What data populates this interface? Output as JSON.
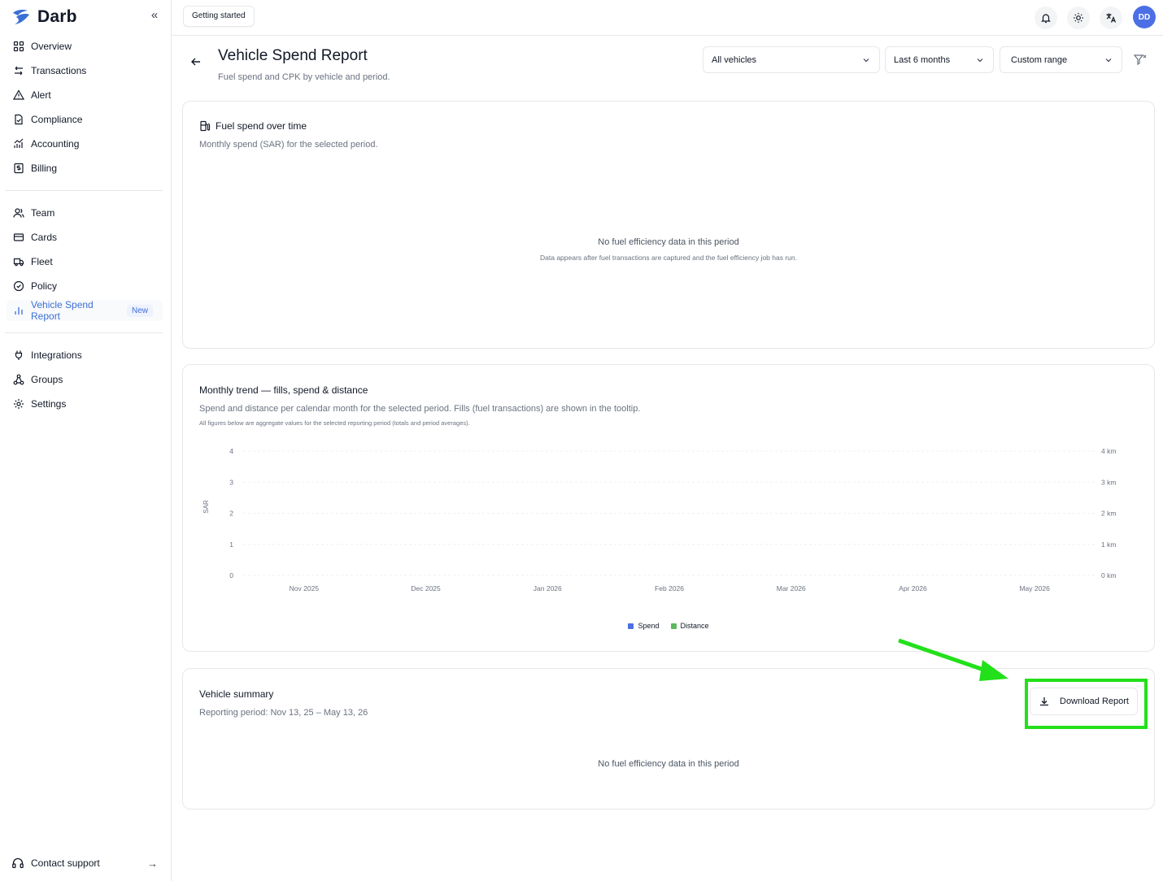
{
  "brand": {
    "name": "Darb",
    "accent": "#3b6fd6"
  },
  "sidebar": {
    "groups": [
      {
        "items": [
          {
            "label": "Overview",
            "icon": "grid-icon"
          },
          {
            "label": "Transactions",
            "icon": "arrows-swap-icon"
          },
          {
            "label": "Alert",
            "icon": "warning-triangle-icon"
          },
          {
            "label": "Compliance",
            "icon": "file-check-icon"
          },
          {
            "label": "Accounting",
            "icon": "chart-line-icon"
          },
          {
            "label": "Billing",
            "icon": "receipt-dollar-icon"
          }
        ]
      },
      {
        "items": [
          {
            "label": "Team",
            "icon": "users-icon"
          },
          {
            "label": "Cards",
            "icon": "credit-card-icon"
          },
          {
            "label": "Fleet",
            "icon": "truck-icon"
          },
          {
            "label": "Policy",
            "icon": "shield-check-icon"
          },
          {
            "label": "Vehicle Spend Report",
            "icon": "bar-chart-icon",
            "badge": "New",
            "active": true
          }
        ]
      },
      {
        "items": [
          {
            "label": "Integrations",
            "icon": "plug-icon"
          },
          {
            "label": "Groups",
            "icon": "network-icon"
          },
          {
            "label": "Settings",
            "icon": "gear-icon"
          }
        ]
      }
    ],
    "contact_support": "Contact support"
  },
  "topbar": {
    "getting_started": "Getting started",
    "avatar_initials": "DD"
  },
  "header": {
    "title": "Vehicle Spend Report",
    "subtitle": "Fuel spend and CPK by vehicle and period."
  },
  "filters": {
    "vehicle": "All vehicles",
    "period": "Last 6 months",
    "range": "Custom range"
  },
  "fuel_card": {
    "title": "Fuel spend over time",
    "description": "Monthly spend (SAR) for the selected period.",
    "empty_title": "No fuel efficiency data in this period",
    "empty_sub": "Data appears after fuel transactions are captured and the fuel efficiency job has run."
  },
  "trend_card": {
    "title": "Monthly trend — fills, spend & distance",
    "description": "Spend and distance per calendar month for the selected period. Fills (fuel transactions) are shown in the tooltip.",
    "note": "All figures below are aggregate values for the selected reporting period (totals and period averages)."
  },
  "chart_data": {
    "type": "line",
    "categories": [
      "Nov 2025",
      "Dec 2025",
      "Jan 2026",
      "Feb 2026",
      "Mar 2026",
      "Apr 2026",
      "May 2026"
    ],
    "ylabel": "SAR",
    "y_ticks": [
      "0",
      "1",
      "2",
      "3",
      "4"
    ],
    "y2_ticks": [
      "0 km",
      "1 km",
      "2 km",
      "3 km",
      "4 km"
    ],
    "ylim": [
      0,
      4
    ],
    "y2lim": [
      0,
      4
    ],
    "grid": true,
    "legend_position": "bottom",
    "series": [
      {
        "name": "Spend",
        "color": "#4c6fe6",
        "values": []
      },
      {
        "name": "Distance",
        "color": "#5cb85c",
        "values": []
      }
    ]
  },
  "summary_card": {
    "title": "Vehicle summary",
    "period": "Reporting period: Nov 13, 25 – May 13, 26",
    "empty_title": "No fuel efficiency data in this period",
    "download_label": "Download Report"
  },
  "annotation": {
    "color": "#22e01a"
  }
}
